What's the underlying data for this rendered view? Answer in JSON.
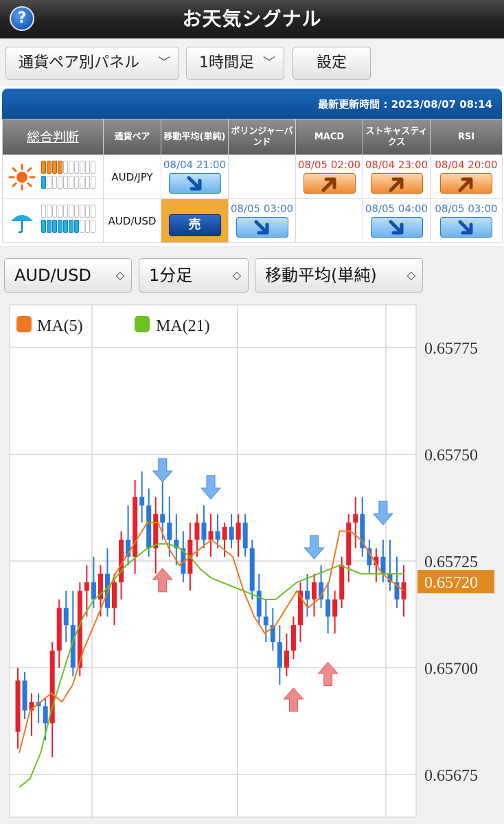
{
  "header": {
    "title": "お天気シグナル",
    "help_icon": "?"
  },
  "top_controls": {
    "panel_select": "通貨ペア別パネル",
    "timeframe_select": "1時間足",
    "settings_button": "設定"
  },
  "panel": {
    "updated_label": "最新更新時間 : 2023/08/07 08:14",
    "headers": [
      "総合判断",
      "通貨ペア",
      "移動平均(単純)",
      "ボリンジャーバンド",
      "MACD",
      "ストキャスティクス",
      "RSI"
    ],
    "rows": [
      {
        "weather_icon": "sun-icon",
        "buy_level": 4,
        "sell_level": 1,
        "segments": 10,
        "pair": "AUD/JPY",
        "signals": [
          {
            "time": "08/04 21:00",
            "dir": "down"
          },
          {
            "time": "",
            "dir": ""
          },
          {
            "time": "08/05 02:00",
            "dir": "up"
          },
          {
            "time": "08/04 23:00",
            "dir": "up"
          },
          {
            "time": "08/04 20:00",
            "dir": "up"
          }
        ]
      },
      {
        "weather_icon": "umbrella-icon",
        "buy_level": 0,
        "sell_level": 7,
        "segments": 10,
        "pair": "AUD/USD",
        "signals": [
          {
            "time": "",
            "dir": "sell",
            "label": "売"
          },
          {
            "time": "08/05 03:00",
            "dir": "down"
          },
          {
            "time": "",
            "dir": ""
          },
          {
            "time": "08/05 04:00",
            "dir": "down"
          },
          {
            "time": "08/05 03:00",
            "dir": "down"
          }
        ]
      }
    ]
  },
  "chart_controls": {
    "pair_select": "AUD/USD",
    "timeframe_select": "1分足",
    "indicator_select": "移動平均(単純)"
  },
  "chart_data": {
    "type": "candlestick",
    "legend": [
      {
        "name": "MA(5)",
        "color": "#f07820"
      },
      {
        "name": "MA(21)",
        "color": "#6cc020"
      }
    ],
    "y_ticks": [
      "0.65775",
      "0.65750",
      "0.65725",
      "0.65700",
      "0.65675"
    ],
    "y_range": [
      0.65665,
      0.65785
    ],
    "current_price": "0.65720",
    "candles": [
      [
        0.65685,
        0.657,
        0.65681,
        0.65697
      ],
      [
        0.65697,
        0.65699,
        0.65688,
        0.6569
      ],
      [
        0.6569,
        0.65694,
        0.65684,
        0.65692
      ],
      [
        0.65692,
        0.65694,
        0.65687,
        0.65691
      ],
      [
        0.65691,
        0.65693,
        0.65683,
        0.65687
      ],
      [
        0.65687,
        0.65706,
        0.65679,
        0.65704
      ],
      [
        0.65704,
        0.65716,
        0.657,
        0.65714
      ],
      [
        0.65714,
        0.65718,
        0.65706,
        0.6571
      ],
      [
        0.6571,
        0.65718,
        0.65698,
        0.657
      ],
      [
        0.657,
        0.6572,
        0.65698,
        0.65718
      ],
      [
        0.65718,
        0.65724,
        0.65712,
        0.6572
      ],
      [
        0.6572,
        0.65726,
        0.65714,
        0.65716
      ],
      [
        0.65716,
        0.65724,
        0.65712,
        0.65722
      ],
      [
        0.65722,
        0.65728,
        0.65712,
        0.65714
      ],
      [
        0.65714,
        0.65722,
        0.6571,
        0.6572
      ],
      [
        0.6572,
        0.65732,
        0.65716,
        0.6573
      ],
      [
        0.6573,
        0.65738,
        0.65724,
        0.65726
      ],
      [
        0.65726,
        0.65744,
        0.65722,
        0.6574
      ],
      [
        0.6574,
        0.65746,
        0.65734,
        0.65738
      ],
      [
        0.65738,
        0.65742,
        0.65726,
        0.65728
      ],
      [
        0.65728,
        0.6574,
        0.65722,
        0.65736
      ],
      [
        0.65736,
        0.65748,
        0.6573,
        0.65734
      ],
      [
        0.65734,
        0.6574,
        0.65726,
        0.6573
      ],
      [
        0.6573,
        0.65736,
        0.65724,
        0.65728
      ],
      [
        0.65728,
        0.65732,
        0.6572,
        0.65722
      ],
      [
        0.65722,
        0.65734,
        0.65718,
        0.6573
      ],
      [
        0.6573,
        0.65736,
        0.65726,
        0.65734
      ],
      [
        0.65734,
        0.65738,
        0.65728,
        0.6573
      ],
      [
        0.6573,
        0.65736,
        0.65726,
        0.65732
      ],
      [
        0.65732,
        0.65736,
        0.65728,
        0.6573
      ],
      [
        0.6573,
        0.65734,
        0.65726,
        0.65733
      ],
      [
        0.65733,
        0.65736,
        0.65728,
        0.6573
      ],
      [
        0.6573,
        0.65736,
        0.65726,
        0.65734
      ],
      [
        0.65734,
        0.65736,
        0.65726,
        0.65728
      ],
      [
        0.65728,
        0.6573,
        0.65716,
        0.65718
      ],
      [
        0.65718,
        0.65722,
        0.6571,
        0.65712
      ],
      [
        0.65712,
        0.65716,
        0.65706,
        0.6571
      ],
      [
        0.6571,
        0.65714,
        0.65704,
        0.65706
      ],
      [
        0.65706,
        0.6571,
        0.65696,
        0.657
      ],
      [
        0.657,
        0.65708,
        0.65698,
        0.65704
      ],
      [
        0.65704,
        0.65712,
        0.65702,
        0.6571
      ],
      [
        0.6571,
        0.6572,
        0.65706,
        0.65718
      ],
      [
        0.65718,
        0.65722,
        0.65712,
        0.65716
      ],
      [
        0.65716,
        0.65722,
        0.65712,
        0.6572
      ],
      [
        0.6572,
        0.65724,
        0.65714,
        0.65716
      ],
      [
        0.65716,
        0.6572,
        0.65708,
        0.65712
      ],
      [
        0.65712,
        0.65718,
        0.65708,
        0.65716
      ],
      [
        0.65716,
        0.65726,
        0.65714,
        0.65724
      ],
      [
        0.65724,
        0.65736,
        0.6572,
        0.65734
      ],
      [
        0.65734,
        0.6574,
        0.65728,
        0.65736
      ],
      [
        0.65736,
        0.6574,
        0.65726,
        0.65728
      ],
      [
        0.65728,
        0.6573,
        0.65722,
        0.65724
      ],
      [
        0.65724,
        0.65728,
        0.6572,
        0.65726
      ],
      [
        0.65726,
        0.6573,
        0.6572,
        0.65722
      ],
      [
        0.65722,
        0.6573,
        0.65718,
        0.6572
      ],
      [
        0.6572,
        0.65726,
        0.65714,
        0.65716
      ],
      [
        0.65716,
        0.65724,
        0.65712,
        0.6572
      ]
    ],
    "ma5": [
      0.6568,
      0.6569,
      0.65692,
      0.65694,
      0.65692,
      0.65696,
      0.65704,
      0.6571,
      0.65716,
      0.65722,
      0.65726,
      0.6573,
      0.65734,
      0.65734,
      0.65728,
      0.65724,
      0.65726,
      0.65728,
      0.6573,
      0.65728,
      0.65726,
      0.65718,
      0.65712,
      0.65708,
      0.6571,
      0.65714,
      0.65718,
      0.65714,
      0.65716,
      0.6572,
      0.65732,
      0.65732,
      0.6573,
      0.65726,
      0.65722,
      0.6572,
      0.65718
    ],
    "ma21": [
      0.65672,
      0.65674,
      0.6568,
      0.6569,
      0.65698,
      0.65706,
      0.65712,
      0.65716,
      0.65718,
      0.65721,
      0.65724,
      0.65726,
      0.65728,
      0.65729,
      0.65729,
      0.65728,
      0.65726,
      0.65723,
      0.65721,
      0.6572,
      0.65719,
      0.65718,
      0.65717,
      0.65716,
      0.65716,
      0.65718,
      0.6572,
      0.65721,
      0.65722,
      0.65723,
      0.65724,
      0.65723,
      0.65722,
      0.65722,
      0.65722,
      0.65722,
      0.65722
    ],
    "signal_arrows": [
      {
        "index": 21,
        "dir": "down"
      },
      {
        "index": 21,
        "dir": "up"
      },
      {
        "index": 28,
        "dir": "down"
      },
      {
        "index": 40,
        "dir": "up"
      },
      {
        "index": 43,
        "dir": "down"
      },
      {
        "index": 45,
        "dir": "up"
      },
      {
        "index": 53,
        "dir": "down"
      }
    ]
  }
}
